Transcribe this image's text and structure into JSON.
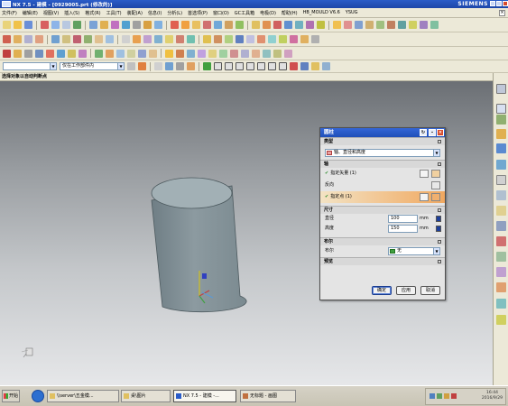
{
  "window": {
    "title": "NX 7.5 - 建模 - [0929005.prt (修改的)]",
    "brand": "SIEMENS"
  },
  "menu": {
    "items": [
      "文件(F)",
      "编辑(E)",
      "视图(V)",
      "插入(S)",
      "格式(R)",
      "工具(T)",
      "装配(A)",
      "信息(I)",
      "分析(L)",
      "首选项(P)",
      "窗口(O)",
      "GC工具箱",
      "电极(D)",
      "帮助(H)",
      "HB_MOULD V6.6",
      "YSUG"
    ]
  },
  "selection_filter": {
    "value": "仅在工作部件内"
  },
  "cue_line": "选择对象以自动判断点",
  "dialog": {
    "title": "圆柱",
    "sections": {
      "type": "类型",
      "axis": "轴",
      "dimensions": "尺寸",
      "boolean": "布尔",
      "settings": "预览"
    },
    "type_value": "轴、直径和高度",
    "specify_vector": "指定矢量 (1)",
    "reverse": "反向",
    "specify_point": "指定点 (1)",
    "diameter_label": "直径",
    "diameter_value": "100",
    "diameter_unit": "mm",
    "height_label": "高度",
    "height_value": "150",
    "height_unit": "mm",
    "boolean_label": "布尔",
    "boolean_value": "无",
    "ok": "确定",
    "apply": "应用",
    "cancel": "取消"
  },
  "taskbar": {
    "start": "开始",
    "tasks": [
      "\\\\server\\五金模...",
      "桌\\图片",
      "NX 7.5 - 建模 -...",
      "无标题 - 画图"
    ],
    "time": "16:44",
    "date": "2016/9/29"
  }
}
